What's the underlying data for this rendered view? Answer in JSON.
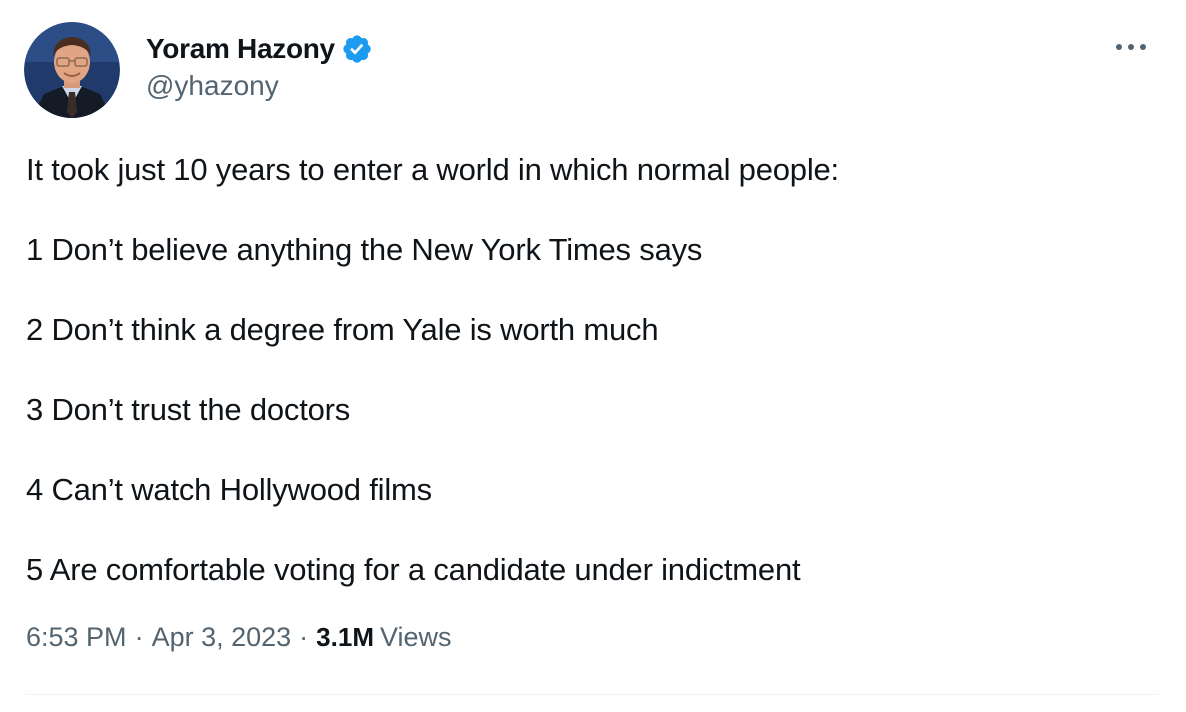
{
  "author": {
    "display_name": "Yoram Hazony",
    "handle": "@yhazony",
    "verified_color": "#1d9bf0"
  },
  "tweet": {
    "lines": [
      "It took just 10 years to enter a world in which normal people:",
      "1 Don’t believe anything the New York Times says",
      "2 Don’t think a degree from Yale is worth much",
      "3 Don’t trust the doctors",
      "4 Can’t watch Hollywood films",
      "5 Are comfortable voting for a candidate under indictment"
    ]
  },
  "meta": {
    "time": "6:53 PM",
    "separator": "·",
    "date": "Apr 3, 2023",
    "views_count": "3.1M",
    "views_label": "Views"
  },
  "icons": {
    "more": "more-options-icon",
    "verified": "verified-badge-icon"
  }
}
